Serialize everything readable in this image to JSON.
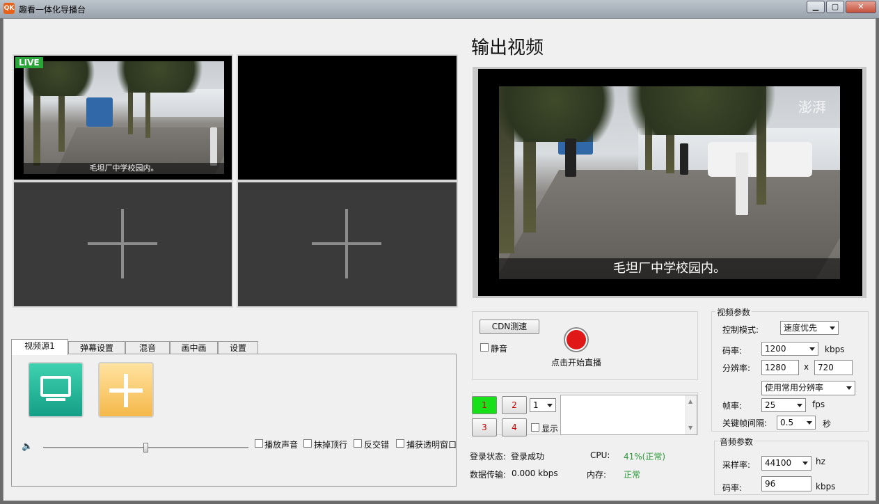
{
  "window": {
    "title": "趣看一体化导播台",
    "app_icon": "QK"
  },
  "grid": {
    "live_badge": "LIVE",
    "cell1_caption": "毛坦厂中学校园内。"
  },
  "output": {
    "heading": "输出视频",
    "caption": "毛坦厂中学校园内。",
    "watermark": "澎湃"
  },
  "tabs": [
    "视频源1",
    "弹幕设置",
    "混音",
    "画中画",
    "设置"
  ],
  "source_panel": {
    "options": [
      "播放声音",
      "抹掉顶行",
      "反交错",
      "捕获透明窗口"
    ]
  },
  "stream": {
    "cdn_button": "CDN测速",
    "mute_label": "静音",
    "start_label": "点击开始直播"
  },
  "scenes": {
    "buttons": [
      "1",
      "2",
      "3",
      "4"
    ],
    "select_value": "1",
    "show_label": "显示"
  },
  "status": {
    "login_label": "登录状态:",
    "login_value": "登录成功",
    "transfer_label": "数据传输:",
    "transfer_value": "0.000 kbps",
    "cpu_label": "CPU:",
    "cpu_value": "41%(正常)",
    "mem_label": "内存:",
    "mem_value": "正常"
  },
  "video_params": {
    "title": "视频参数",
    "control_mode_label": "控制模式:",
    "control_mode_value": "速度优先",
    "bitrate_label": "码率:",
    "bitrate_value": "1200",
    "bitrate_unit": "kbps",
    "resolution_label": "分辨率:",
    "res_width": "1280",
    "res_x": "x",
    "res_height": "720",
    "common_res_value": "使用常用分辨率",
    "fps_label": "帧率:",
    "fps_value": "25",
    "fps_unit": "fps",
    "keyframe_label": "关键帧间隔:",
    "keyframe_value": "0.5",
    "keyframe_unit": "秒"
  },
  "audio_params": {
    "title": "音频参数",
    "samplerate_label": "采样率:",
    "samplerate_value": "44100",
    "samplerate_unit": "hz",
    "bitrate_label": "码率:",
    "bitrate_value": "96",
    "bitrate_unit": "kbps"
  },
  "colors": {
    "live_green": "#2aa53a",
    "record_red": "#e01818",
    "scene_active": "#18e018",
    "status_green": "#2c9a3a"
  }
}
